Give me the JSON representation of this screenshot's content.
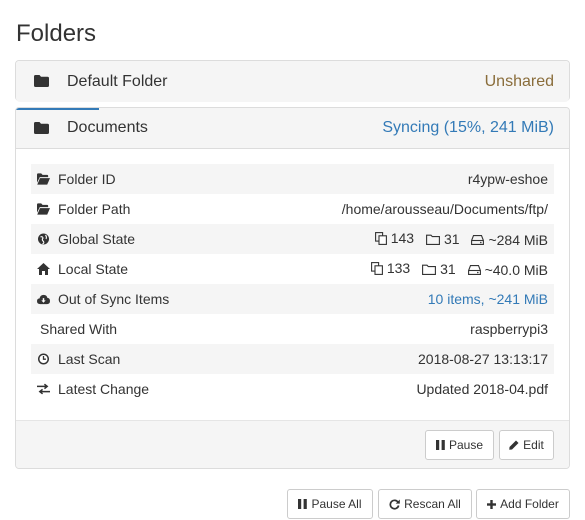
{
  "page": {
    "title": "Folders"
  },
  "colors": {
    "unshared": "#8a6d3b",
    "link": "#337ab7",
    "progress": "#337ab7"
  },
  "folders": [
    {
      "name": "Default Folder",
      "status": "Unshared",
      "icon": "folder-icon"
    },
    {
      "name": "Documents",
      "status": "Syncing (15%, 241 MiB)",
      "progress_fraction": 0.15,
      "icon": "folder-icon",
      "details": {
        "folder_id": {
          "label": "Folder ID",
          "value": "r4ypw-eshoe",
          "icon": "folder-open-icon"
        },
        "folder_path": {
          "label": "Folder Path",
          "value": "/home/arousseau/Documents/ftp/",
          "icon": "folder-open-icon"
        },
        "global_state": {
          "label": "Global State",
          "files": "143",
          "dirs": "31",
          "size": "~284 MiB",
          "icon": "globe-icon"
        },
        "local_state": {
          "label": "Local State",
          "files": "133",
          "dirs": "31",
          "size": "~40.0 MiB",
          "icon": "home-icon"
        },
        "out_of_sync": {
          "label": "Out of Sync Items",
          "value": "10 items, ~241 MiB",
          "icon": "cloud-download-icon"
        },
        "shared_with": {
          "label": "Shared With",
          "value": "raspberrypi3"
        },
        "last_scan": {
          "label": "Last Scan",
          "value": "2018-08-27 13:13:17",
          "icon": "clock-icon"
        },
        "latest_change": {
          "label": "Latest Change",
          "value": "Updated 2018-04.pdf",
          "icon": "exchange-icon"
        }
      },
      "actions": {
        "pause": "Pause",
        "edit": "Edit"
      }
    }
  ],
  "footer": {
    "pause_all": "Pause All",
    "rescan_all": "Rescan All",
    "add_folder": "Add Folder"
  }
}
